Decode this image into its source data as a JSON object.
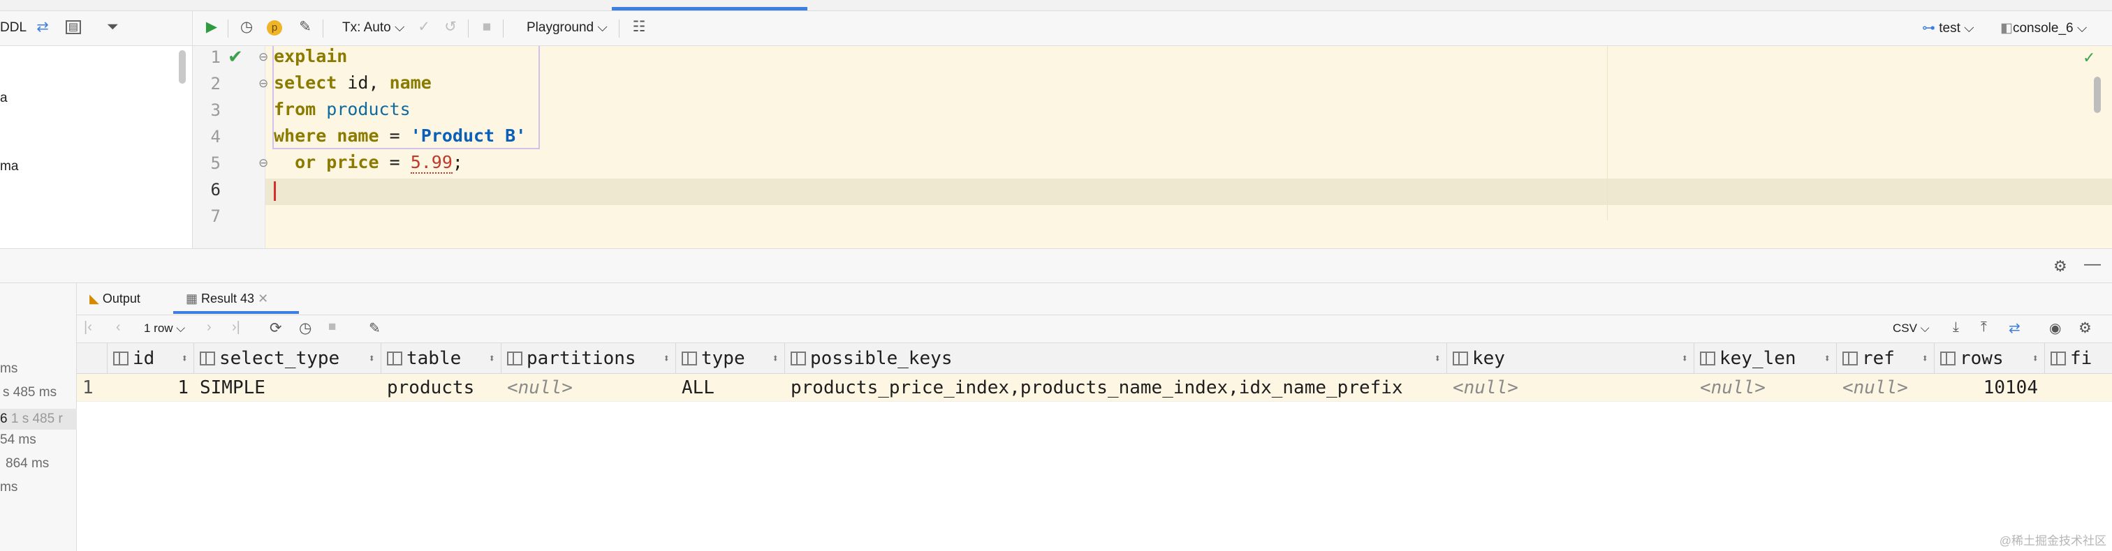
{
  "left_toolbar": {
    "ddl_label": "DDL"
  },
  "toolbar": {
    "tx_label": "Tx: Auto",
    "playground_label": "Playground",
    "datasource_label": "test",
    "console_label": "console_6"
  },
  "left_tree": {
    "items": [
      "a",
      "ma"
    ]
  },
  "editor": {
    "line_numbers": [
      "1",
      "2",
      "3",
      "4",
      "5",
      "6",
      "7"
    ],
    "lines": [
      {
        "k": "explain"
      },
      {
        "k": "select",
        "rest_a": " id, ",
        "k2": "name"
      },
      {
        "k": "from",
        "t": " products"
      },
      {
        "k": "where",
        "rest_a": " ",
        "k2": "name",
        "rest_b": " = ",
        "s": "'Product B'"
      },
      {
        "k": "  or",
        "rest_a": " ",
        "k2": "price",
        "rest_b": " = ",
        "n": "5.99",
        "end": ";"
      }
    ]
  },
  "results": {
    "output_tab": "Output",
    "result_tab": "Result 43",
    "row_count": "1 row",
    "export_format": "CSV",
    "columns": [
      "id",
      "select_type",
      "table",
      "partitions",
      "type",
      "possible_keys",
      "key",
      "key_len",
      "ref",
      "rows",
      "fi"
    ],
    "row": {
      "num": "1",
      "id": "1",
      "select_type": "SIMPLE",
      "table": "products",
      "partitions": "<null>",
      "type": "ALL",
      "possible_keys": "products_price_index,products_name_index,idx_name_prefix",
      "key": "<null>",
      "key_len": "<null>",
      "ref": "<null>",
      "rows": "10104"
    }
  },
  "history": [
    "ms",
    "s 485 ms",
    "6",
    "1 s 485 r",
    "54 ms",
    "864 ms",
    "ms"
  ],
  "watermark": "@稀土掘金技术社区",
  "colors": {
    "accent": "#3d7fe0",
    "editor_bg": "#fdf6e3",
    "keyword": "#8a7a00",
    "string": "#0a5fb8",
    "number": "#c0392b"
  }
}
